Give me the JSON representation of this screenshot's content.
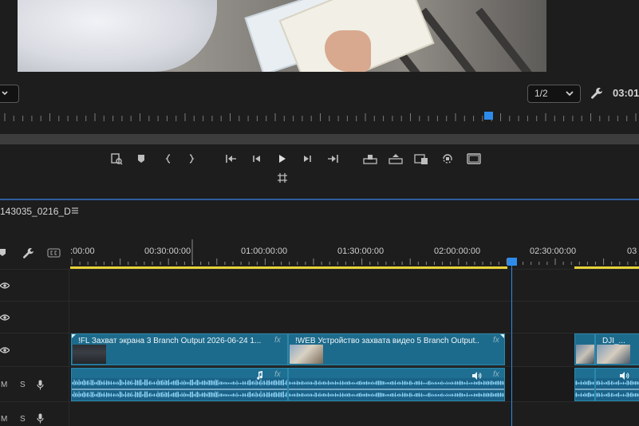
{
  "program_monitor": {
    "zoom_select": "",
    "resolution_select": "1/2",
    "timecode": "03:01",
    "transport_buttons": [
      "add-marker-frame-icon",
      "add-marker-icon",
      "mark-in-icon",
      "mark-out-icon",
      "go-to-in-icon",
      "step-back-icon",
      "play-icon",
      "step-forward-icon",
      "go-to-out-icon",
      "lift-icon",
      "extract-icon",
      "export-frame-icon",
      "insert-icon",
      "comparison-view-icon",
      "safe-margins-icon"
    ]
  },
  "timeline": {
    "sequence_name": "143035_0216_D",
    "ruler_labels": [
      ":00:00",
      "00:30:00:00",
      "01:00:00:00",
      "01:30:00:00",
      "02:00:00:00",
      "02:30:00:00",
      "03"
    ],
    "tracks": {
      "audio_labels": {
        "mute": "M",
        "solo": "S"
      }
    },
    "clips": {
      "video": [
        {
          "title": "!FL Захват экрана 3 Branch Output 2026-06-24 1...",
          "fx": "fx"
        },
        {
          "title": "!WEB Устройство захвата видео 5 Branch Output...",
          "fx": "fx"
        },
        {
          "title": "DJI_...",
          "fx": ""
        }
      ],
      "audio": [
        {
          "fx": "fx",
          "icon": "music-note-icon"
        },
        {
          "fx": "fx",
          "icon": "speaker-icon"
        },
        {
          "fx": "",
          "icon": "speaker-icon"
        }
      ]
    }
  },
  "colors": {
    "accent": "#2d8ceb",
    "clip": "#1f6f90",
    "work_area": "#e8d33a",
    "panel_bg": "#1d1d1d"
  }
}
